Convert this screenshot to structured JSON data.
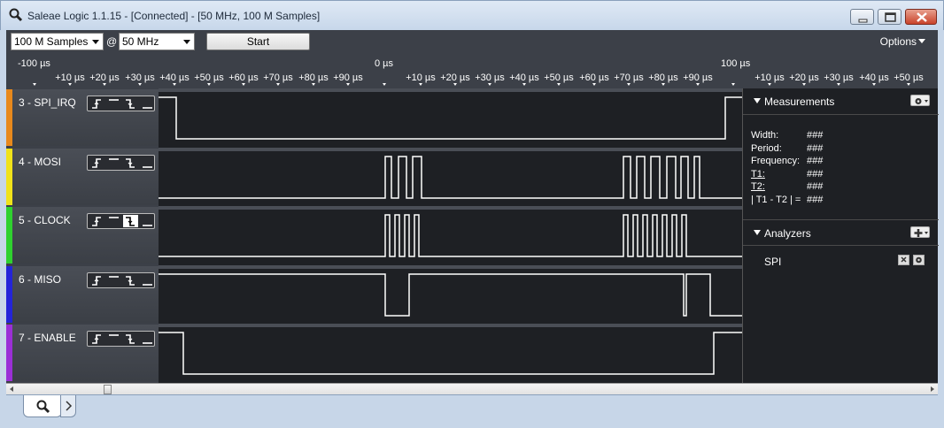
{
  "window": {
    "title": "Saleae Logic 1.1.15 - [Connected] - [50 MHz, 100 M Samples]"
  },
  "toolbar": {
    "samples_value": "100 M Samples",
    "at_label": "@",
    "rate_value": "50 MHz",
    "start_label": "Start",
    "options_label": "Options"
  },
  "ruler": {
    "major": [
      "-100 µs",
      "0 µs",
      "100 µs"
    ],
    "minor": [
      "+10 µs",
      "+20 µs",
      "+30 µs",
      "+40 µs",
      "+50 µs",
      "+60 µs",
      "+70 µs",
      "+80 µs",
      "+90 µs"
    ],
    "minor_after_100": [
      "+10 µs",
      "+20 µs",
      "+30 µs",
      "+40 µs",
      "+50 µs"
    ]
  },
  "channels": [
    {
      "name": "3 - SPI_IRQ",
      "color": "#e8891c"
    },
    {
      "name": "4 - MOSI",
      "color": "#f0e21a"
    },
    {
      "name": "5 - CLOCK",
      "color": "#2fd12f"
    },
    {
      "name": "6 - MISO",
      "color": "#2424d8"
    },
    {
      "name": "7 - ENABLE",
      "color": "#9b2fd6"
    }
  ],
  "measurements": {
    "title": "Measurements",
    "rows": [
      {
        "key": "Width:",
        "value": "###"
      },
      {
        "key": "Period:",
        "value": "###"
      },
      {
        "key": "Frequency:",
        "value": "###"
      },
      {
        "key": "T1:",
        "value": "###"
      },
      {
        "key": "T2:",
        "value": "###"
      },
      {
        "key": "| T1 - T2 | =",
        "value": "###"
      }
    ]
  },
  "analyzers": {
    "title": "Analyzers",
    "items": [
      {
        "name": "SPI"
      }
    ]
  }
}
